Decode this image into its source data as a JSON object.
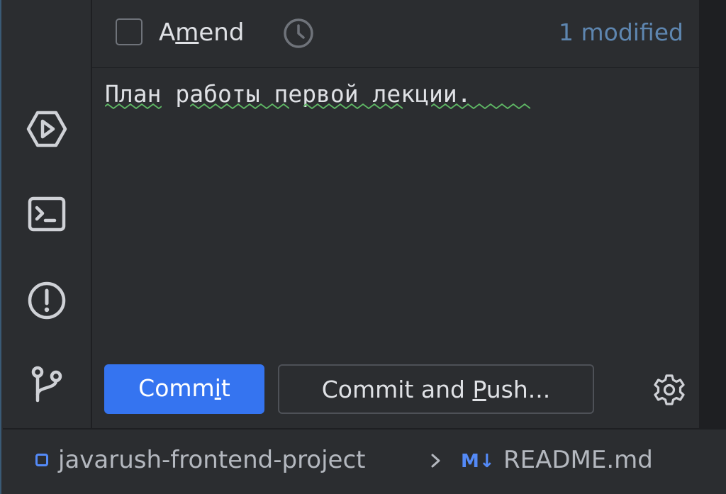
{
  "toolstrip": {
    "items": [
      {
        "name": "run-icon"
      },
      {
        "name": "terminal-icon"
      },
      {
        "name": "problems-icon"
      },
      {
        "name": "git-icon"
      }
    ]
  },
  "commit_panel": {
    "amend_label_pre": "A",
    "amend_label_mnemonic": "m",
    "amend_label_post": "end",
    "amend_checked": false,
    "modified_count": "1 modified",
    "message_words": [
      "План",
      "работы",
      "первой",
      "лекции"
    ],
    "message_end": ".",
    "commit_pre": "Comm",
    "commit_mnemonic": "i",
    "commit_post": "t",
    "push_pre": "Commit and ",
    "push_mnemonic": "P",
    "push_post": "ush..."
  },
  "statusbar": {
    "project": "javarush-frontend-project",
    "file_icon_label": "M↓",
    "file": "README.md"
  },
  "colors": {
    "accent": "#3574f0",
    "modified": "#5e86b0",
    "spell_underline": "#5fb865"
  }
}
